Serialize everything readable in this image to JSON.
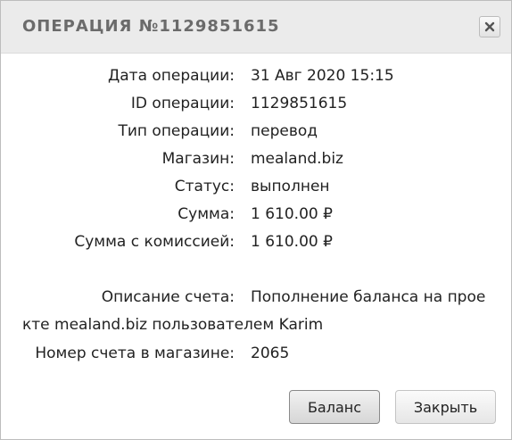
{
  "dialog": {
    "title": "ОПЕРАЦИЯ №1129851615",
    "close_icon": "close-icon"
  },
  "details": {
    "date_label": "Дата операции:",
    "date_value": "31 Авг 2020 15:15",
    "id_label": "ID операции:",
    "id_value": "1129851615",
    "type_label": "Тип операции:",
    "type_value": "перевод",
    "shop_label": "Магазин:",
    "shop_value": "mealand.biz",
    "status_label": "Статус:",
    "status_value": "выполнен",
    "amount_label": "Сумма:",
    "amount_value": "1 610.00 ₽",
    "amount_fee_label": "Сумма с комиссией:",
    "amount_fee_value": "1 610.00 ₽",
    "description_label": "Описание счета:",
    "description_line1": "Пополнение баланса на прое",
    "description_line2": "кте mealand.biz пользователем Karim",
    "invoice_label": "Номер счета в магазине:",
    "invoice_value": "2065"
  },
  "buttons": {
    "balance_label": "Баланс",
    "close_label": "Закрыть"
  }
}
